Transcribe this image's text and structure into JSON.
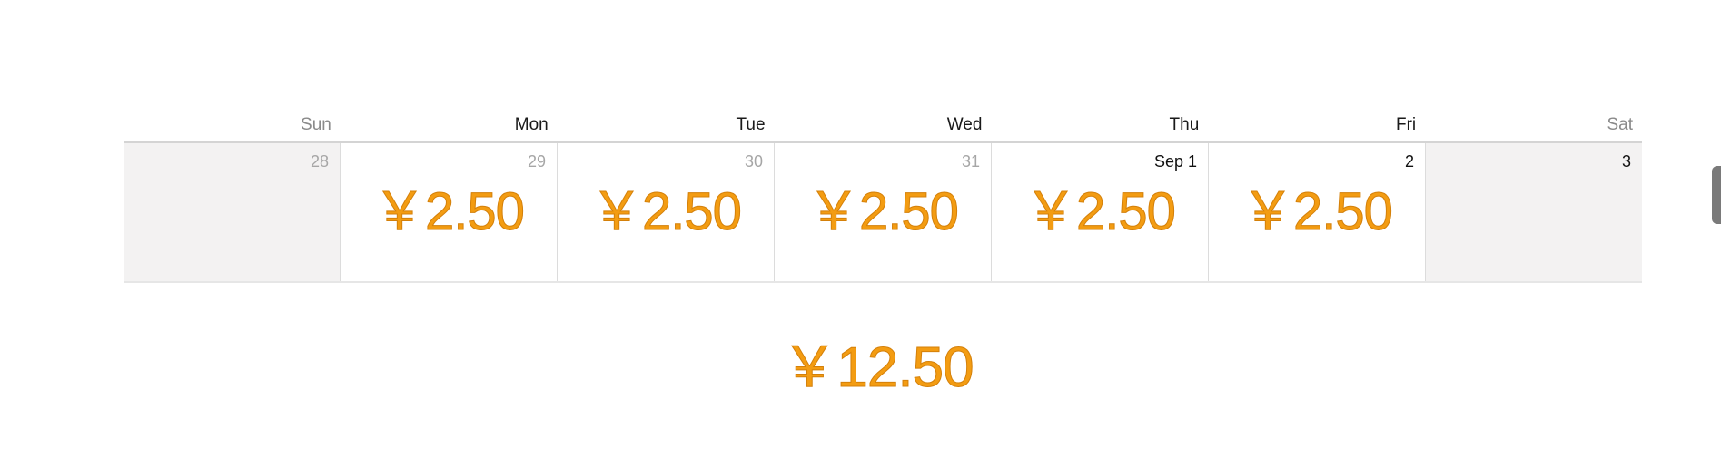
{
  "week": {
    "headers": [
      "Sun",
      "Mon",
      "Tue",
      "Wed",
      "Thu",
      "Fri",
      "Sat"
    ],
    "days": [
      {
        "date": "28",
        "amount": ""
      },
      {
        "date": "29",
        "amount": "￥2.50"
      },
      {
        "date": "30",
        "amount": "￥2.50"
      },
      {
        "date": "31",
        "amount": "￥2.50"
      },
      {
        "date": "Sep 1",
        "amount": "￥2.50"
      },
      {
        "date": "2",
        "amount": "￥2.50"
      },
      {
        "date": "3",
        "amount": ""
      }
    ]
  },
  "total": "￥12.50",
  "colors": {
    "amount": "#f39c12",
    "weekend_bg": "#f3f2f2",
    "grid_line": "#dcdcdc"
  }
}
